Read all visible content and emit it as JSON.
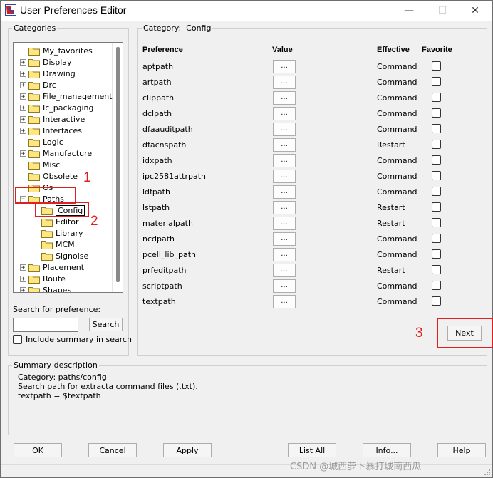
{
  "window": {
    "title": "User Preferences Editor",
    "minimize": "—",
    "maximize": "☐",
    "close": "✕"
  },
  "categories": {
    "label": "Categories",
    "tree": [
      {
        "label": "My_favorites",
        "expander": "",
        "level": 0
      },
      {
        "label": "Display",
        "expander": "+",
        "level": 0
      },
      {
        "label": "Drawing",
        "expander": "+",
        "level": 0
      },
      {
        "label": "Drc",
        "expander": "+",
        "level": 0
      },
      {
        "label": "File_management",
        "expander": "+",
        "level": 0
      },
      {
        "label": "Ic_packaging",
        "expander": "+",
        "level": 0
      },
      {
        "label": "Interactive",
        "expander": "+",
        "level": 0
      },
      {
        "label": "Interfaces",
        "expander": "+",
        "level": 0
      },
      {
        "label": "Logic",
        "expander": "",
        "level": 0
      },
      {
        "label": "Manufacture",
        "expander": "+",
        "level": 0
      },
      {
        "label": "Misc",
        "expander": "",
        "level": 0
      },
      {
        "label": "Obsolete",
        "expander": "",
        "level": 0
      },
      {
        "label": "Os",
        "expander": "",
        "level": 0
      },
      {
        "label": "Paths",
        "expander": "−",
        "level": 0
      },
      {
        "label": "Config",
        "expander": "",
        "level": 1,
        "selected": true
      },
      {
        "label": "Editor",
        "expander": "",
        "level": 1
      },
      {
        "label": "Library",
        "expander": "",
        "level": 1
      },
      {
        "label": "MCM",
        "expander": "",
        "level": 1
      },
      {
        "label": "Signoise",
        "expander": "",
        "level": 1
      },
      {
        "label": "Placement",
        "expander": "+",
        "level": 0
      },
      {
        "label": "Route",
        "expander": "+",
        "level": 0
      },
      {
        "label": "Shapes",
        "expander": "+",
        "level": 0
      }
    ],
    "search_label": "Search for preference:",
    "search_value": "",
    "search_button": "Search",
    "include_summary": "Include summary in search"
  },
  "category_panel": {
    "label_prefix": "Category:",
    "label_value": "Config",
    "headers": {
      "preference": "Preference",
      "value": "Value",
      "effective": "Effective",
      "favorite": "Favorite"
    },
    "dots": "...",
    "rows": [
      {
        "name": "aptpath",
        "effective": "Command"
      },
      {
        "name": "artpath",
        "effective": "Command"
      },
      {
        "name": "clippath",
        "effective": "Command"
      },
      {
        "name": "dclpath",
        "effective": "Command"
      },
      {
        "name": "dfaauditpath",
        "effective": "Command"
      },
      {
        "name": "dfacnspath",
        "effective": "Restart"
      },
      {
        "name": "idxpath",
        "effective": "Command"
      },
      {
        "name": "ipc2581attrpath",
        "effective": "Command"
      },
      {
        "name": "ldfpath",
        "effective": "Command"
      },
      {
        "name": "lstpath",
        "effective": "Restart"
      },
      {
        "name": "materialpath",
        "effective": "Restart"
      },
      {
        "name": "ncdpath",
        "effective": "Command"
      },
      {
        "name": "pcell_lib_path",
        "effective": "Command"
      },
      {
        "name": "prfeditpath",
        "effective": "Restart"
      },
      {
        "name": "scriptpath",
        "effective": "Command"
      },
      {
        "name": "textpath",
        "effective": "Command"
      }
    ],
    "next_button": "Next"
  },
  "summary": {
    "label": "Summary description",
    "line1": "Category: paths/config",
    "line2": "Search path for extracta command files (.txt).",
    "line3": "textpath = $textpath"
  },
  "buttons": {
    "ok": "OK",
    "cancel": "Cancel",
    "apply": "Apply",
    "list_all": "List All",
    "info": "Info...",
    "help": "Help"
  },
  "annotations": {
    "n1": "1",
    "n2": "2",
    "n3": "3"
  },
  "watermark": "CSDN @城西萝卜暴打城南西瓜",
  "colors": {
    "annotation_red": "#e02020",
    "folder_yellow": "#ffe680"
  }
}
